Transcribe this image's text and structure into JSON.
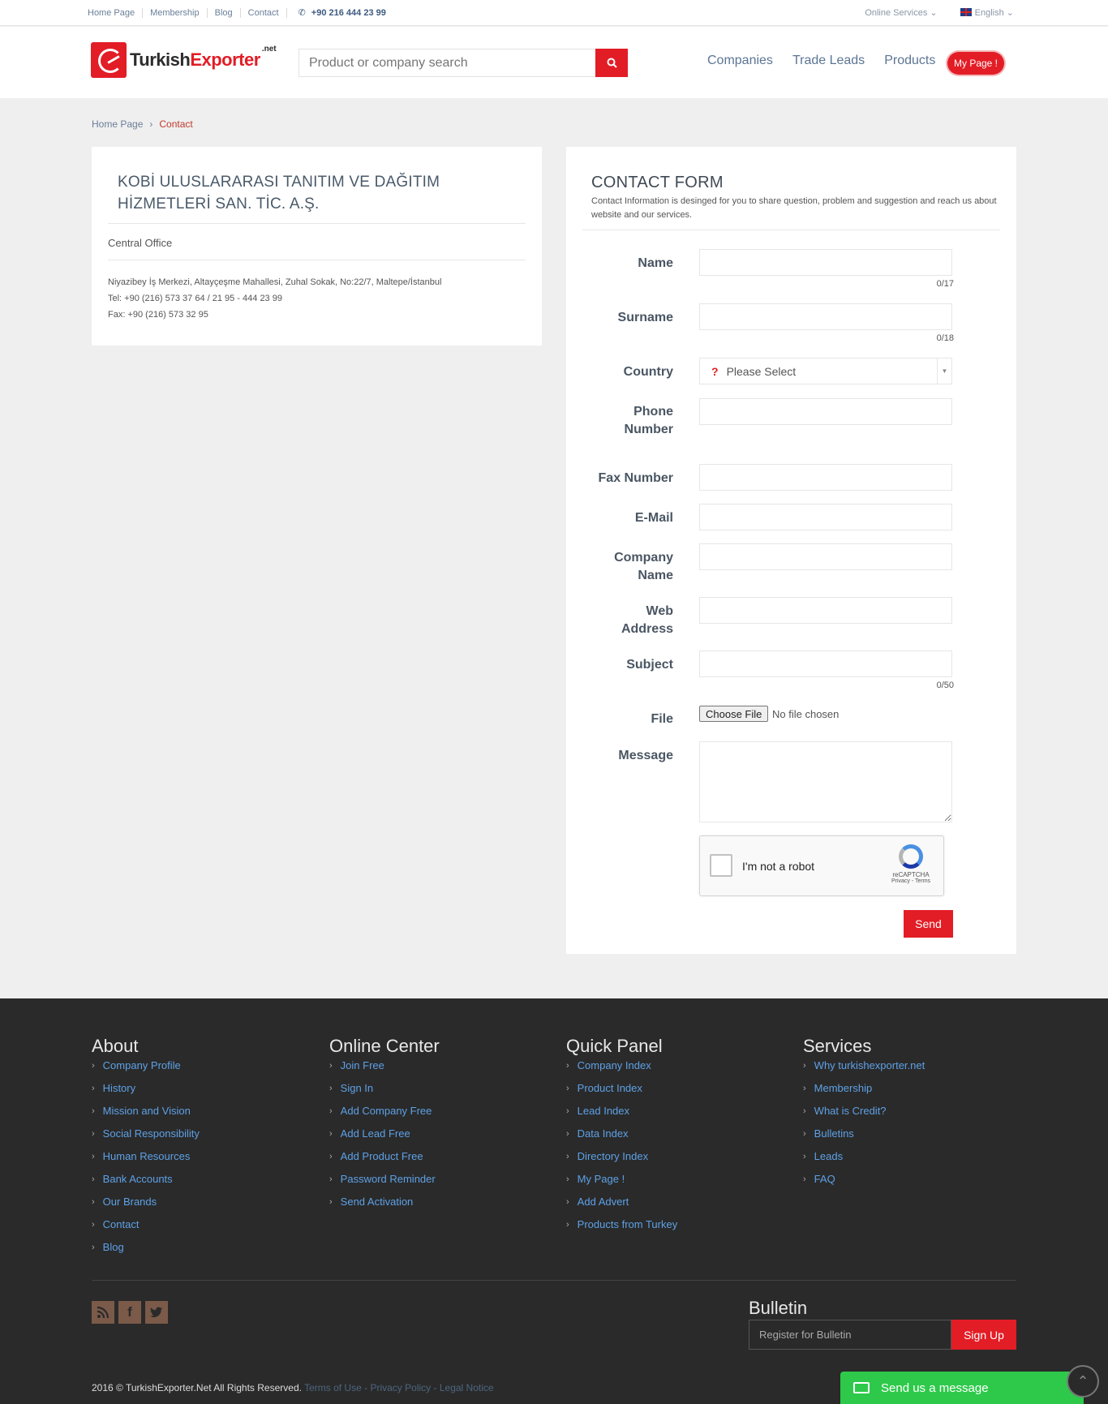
{
  "topbar": {
    "links": [
      "Home Page",
      "Membership",
      "Blog",
      "Contact"
    ],
    "phone": "+90 216 444 23 99",
    "online_services": "Online Services",
    "language": "English"
  },
  "header": {
    "logo_part1": "Turkish",
    "logo_part2": "Exporter",
    "logo_suffix": ".net",
    "search_placeholder": "Product or company search",
    "nav": [
      "Companies",
      "Trade Leads",
      "Products"
    ],
    "mypage": "My Page !"
  },
  "breadcrumb": {
    "home": "Home Page",
    "current": "Contact"
  },
  "company": {
    "name": "KOBİ ULUSLARARASI TANITIM VE DAĞITIM HİZMETLERİ SAN. TİC. A.Ş.",
    "office": "Central Office",
    "address": "Niyazibey İş Merkezi, Altayçeşme Mahallesi, Zuhal Sokak, No:22/7, Maltepe/İstanbul",
    "tel": "Tel: +90 (216) 573 37 64 / 21 95 - 444 23 99",
    "fax": "Fax: +90 (216) 573 32 95"
  },
  "form": {
    "title": "CONTACT FORM",
    "description": "Contact Information is desinged for you to share question, problem and suggestion and reach us about website and our services.",
    "labels": {
      "name": "Name",
      "surname": "Surname",
      "country": "Country",
      "phone": "Phone Number",
      "fax": "Fax Number",
      "email": "E-Mail",
      "company": "Company Name",
      "web": "Web Address",
      "subject": "Subject",
      "file": "File",
      "message": "Message"
    },
    "counters": {
      "name": "0/17",
      "surname": "0/18",
      "subject": "0/50"
    },
    "country_select": "Please Select",
    "file_button": "Choose File",
    "file_status": "No file chosen",
    "captcha_text": "I'm not a robot",
    "captcha_brand": "reCAPTCHA",
    "captcha_links": "Privacy - Terms",
    "send": "Send"
  },
  "footer": {
    "columns": [
      {
        "title": "About",
        "items": [
          "Company Profile",
          "History",
          "Mission and Vision",
          "Social Responsibility",
          "Human Resources",
          "Bank Accounts",
          "Our Brands",
          "Contact",
          "Blog"
        ]
      },
      {
        "title": "Online Center",
        "items": [
          "Join Free",
          "Sign In",
          "Add Company Free",
          "Add Lead Free",
          "Add Product Free",
          "Password Reminder",
          "Send Activation"
        ]
      },
      {
        "title": "Quick Panel",
        "items": [
          "Company Index",
          "Product Index",
          "Lead Index",
          "Data Index",
          "Directory Index",
          "My Page !",
          "Add Advert",
          "Products from Turkey"
        ]
      },
      {
        "title": "Services",
        "items": [
          "Why turkishexporter.net",
          "Membership",
          "What is Credit?",
          "Bulletins",
          "Leads",
          "FAQ"
        ]
      }
    ],
    "bulletin_title": "Bulletin",
    "bulletin_placeholder": "Register for Bulletin",
    "signup": "Sign Up",
    "copyright": "2016 © TurkishExporter.Net All Rights Reserved.",
    "terms": "Terms of Use",
    "privacy": "Privacy Policy",
    "legal": "Legal Notice",
    "send_message": "Send us a message"
  }
}
